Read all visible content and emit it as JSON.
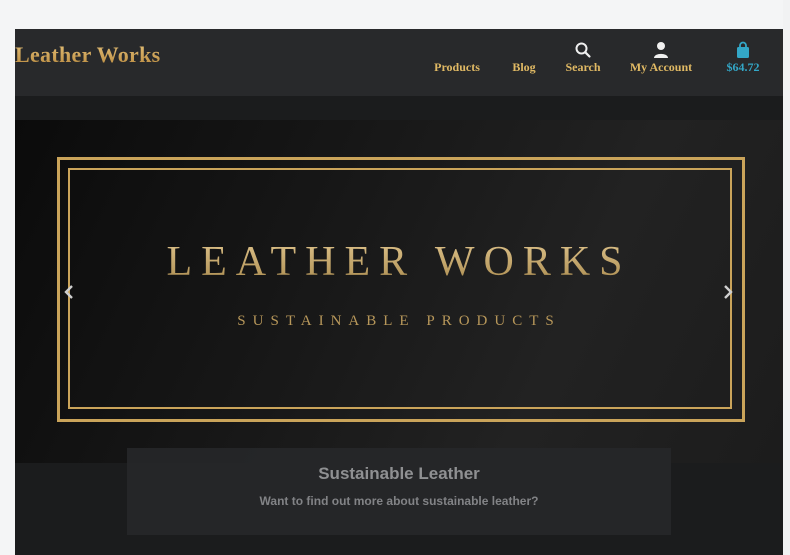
{
  "header": {
    "brand": "Leather Works",
    "nav": {
      "products": "Products",
      "blog": "Blog",
      "search": "Search",
      "account": "My Account",
      "cart_total": "$64.72"
    }
  },
  "hero": {
    "title": "LEATHER WORKS",
    "subtitle": "SUSTAINABLE PRODUCTS"
  },
  "caption": {
    "title": "Sustainable Leather",
    "text": "Want to find out more about sustainable leather?"
  },
  "colors": {
    "gold": "#caa45a",
    "cart": "#33a7c7",
    "header_bg": "#28292b"
  }
}
